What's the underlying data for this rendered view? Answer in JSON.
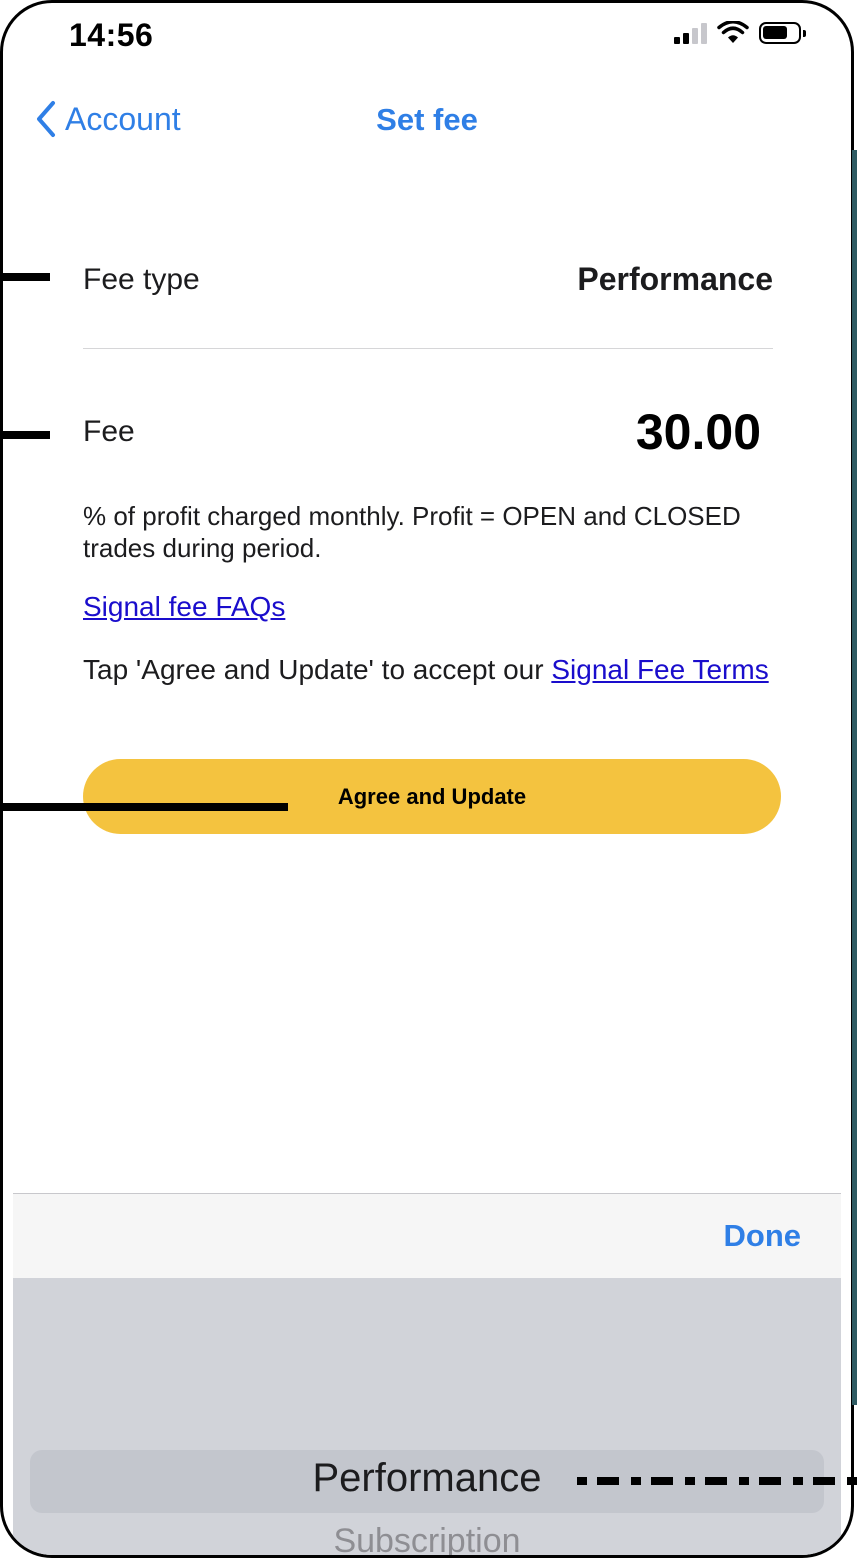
{
  "status_bar": {
    "time": "14:56"
  },
  "nav": {
    "back_label": "Account",
    "title": "Set fee"
  },
  "fee_type": {
    "label": "Fee type",
    "value": "Performance"
  },
  "fee": {
    "label": "Fee",
    "value": "30.00"
  },
  "description": "% of profit charged monthly. Profit = OPEN and CLOSED trades during period.",
  "faq_link": "Signal fee FAQs",
  "terms": {
    "prefix": "Tap 'Agree and Update' to accept our ",
    "link": "Signal Fee Terms"
  },
  "agree_button": "Agree and Update",
  "toolbar": {
    "done_label": "Done"
  },
  "picker": {
    "selected": "Performance",
    "options": [
      "Performance",
      "Subscription"
    ],
    "next": "Subscription"
  },
  "colors": {
    "accent": "#2f7fe6",
    "button": "#f4c33f",
    "link": "#1a0dcc",
    "picker_bg": "#d1d3d9"
  }
}
